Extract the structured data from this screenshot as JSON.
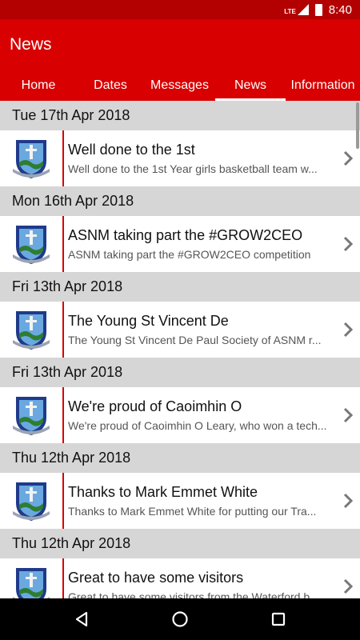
{
  "status": {
    "time": "8:40",
    "network": "LTE"
  },
  "app": {
    "title": "News"
  },
  "tabs": [
    {
      "label": "Home"
    },
    {
      "label": "Dates"
    },
    {
      "label": "Messages"
    },
    {
      "label": "News"
    },
    {
      "label": "Information"
    }
  ],
  "active_tab": "News",
  "sections": [
    {
      "date": "Tue 17th Apr 2018",
      "title": "Well done to the 1st",
      "subtitle": "Well done to the 1st Year girls basketball team w..."
    },
    {
      "date": "Mon 16th Apr 2018",
      "title": "ASNM taking part the #GROW2CEO",
      "subtitle": "ASNM taking part the #GROW2CEO competition"
    },
    {
      "date": "Fri 13th Apr 2018",
      "title": "The Young St Vincent De",
      "subtitle": "The Young St Vincent De Paul Society of ASNM r..."
    },
    {
      "date": "Fri 13th Apr 2018",
      "title": "We're proud of Caoimhin O",
      "subtitle": "We're proud of Caoimhin O Leary, who won a tech..."
    },
    {
      "date": "Thu 12th Apr 2018",
      "title": "Thanks to Mark Emmet White",
      "subtitle": "Thanks to Mark Emmet White for putting our Tra..."
    },
    {
      "date": "Thu 12th Apr 2018",
      "title": "Great to have some visitors",
      "subtitle": "Great to have some visitors from the Waterford b..."
    }
  ],
  "icons": {
    "item_logo": "school-crest-icon",
    "item_chevron": "chevron-right-icon",
    "nav_back": "back-triangle-icon",
    "nav_home": "home-circle-icon",
    "nav_recents": "recents-square-icon"
  },
  "colors": {
    "primary": "#d80000",
    "status_bar": "#b30000",
    "section_header": "#d6d6d6"
  }
}
